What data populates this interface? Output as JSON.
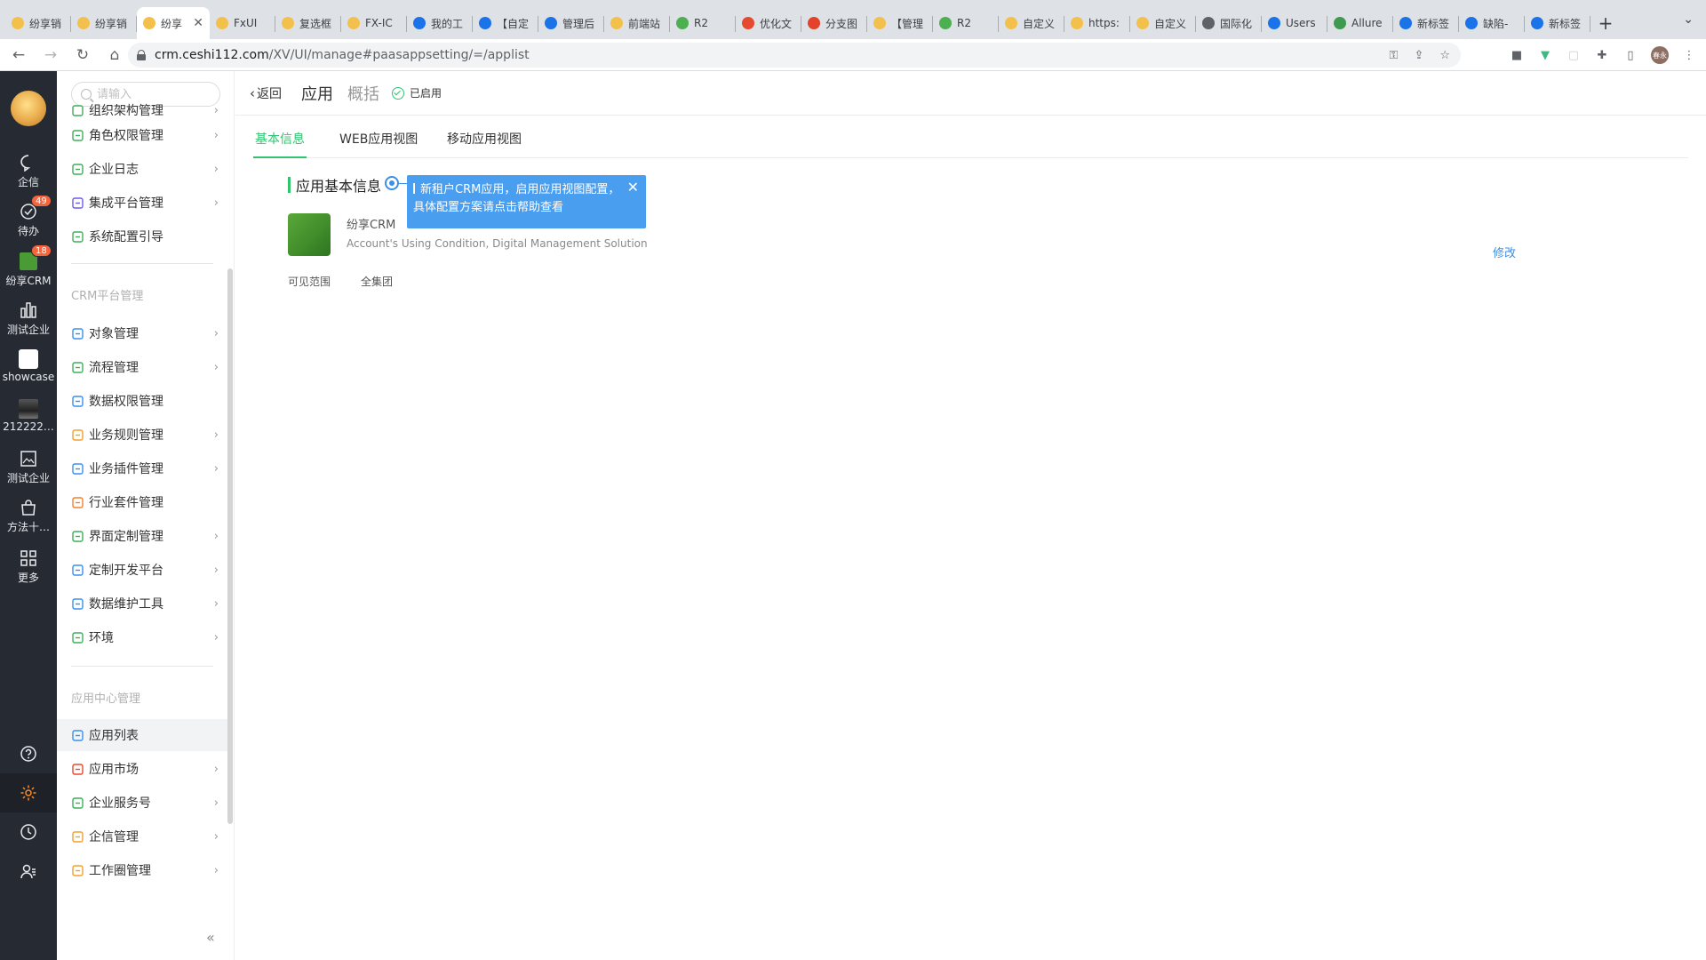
{
  "browser": {
    "tabs": [
      {
        "label": "纷享销",
        "favicon": "#f3c14b"
      },
      {
        "label": "纷享销",
        "favicon": "#f3c14b"
      },
      {
        "label": "纷享",
        "favicon": "#f3c14b",
        "active": true
      },
      {
        "label": "FxUI",
        "favicon": "#f3c14b"
      },
      {
        "label": "复选框",
        "favicon": "#f3c14b"
      },
      {
        "label": "FX-IC",
        "favicon": "#f3c14b"
      },
      {
        "label": "我的工",
        "favicon": "#1a73e8"
      },
      {
        "label": "【自定",
        "favicon": "#1a73e8"
      },
      {
        "label": "管理后",
        "favicon": "#1a73e8"
      },
      {
        "label": "前端站",
        "favicon": "#f3c14b"
      },
      {
        "label": "R2",
        "favicon": "#4caf50"
      },
      {
        "label": "优化文",
        "favicon": "#e5492f"
      },
      {
        "label": "分支图",
        "favicon": "#e24329"
      },
      {
        "label": "【管理",
        "favicon": "#f3c14b"
      },
      {
        "label": "R2",
        "favicon": "#4caf50"
      },
      {
        "label": "自定义",
        "favicon": "#f3c14b"
      },
      {
        "label": "https:",
        "favicon": "#f3c14b"
      },
      {
        "label": "自定义",
        "favicon": "#f3c14b"
      },
      {
        "label": "国际化",
        "favicon": "#5f6368"
      },
      {
        "label": "Users",
        "favicon": "#1a73e8"
      },
      {
        "label": "Allure",
        "favicon": "#3f9a4f"
      },
      {
        "label": "新标签",
        "favicon": "#1a73e8"
      },
      {
        "label": "缺陷-",
        "favicon": "#1a73e8"
      },
      {
        "label": "新标签",
        "favicon": "#1a73e8"
      }
    ],
    "tab_close": "✕",
    "new_tab": "+",
    "url_host": "crm.ceshi112.com",
    "url_path": "/XV/UI/manage#paasappsetting/=/applist",
    "profile_initials": "春永"
  },
  "rail": {
    "items": [
      {
        "label": "企信",
        "icon": "chat-bubble-icon"
      },
      {
        "label": "待办",
        "icon": "check-circle-icon",
        "badge": "49"
      },
      {
        "label": "纷享CRM",
        "icon": "crm-app-icon",
        "badge": "18"
      },
      {
        "label": "测试企业",
        "icon": "chart-bars-icon"
      },
      {
        "label": "showcase",
        "icon": "white-square-icon"
      },
      {
        "label": "212222…",
        "icon": "image-thumb-icon"
      },
      {
        "label": "测试企业",
        "icon": "broken-image-icon"
      },
      {
        "label": "方法十…",
        "icon": "shopping-bag-icon"
      },
      {
        "label": "更多",
        "icon": "grid-icon"
      }
    ],
    "bottom": [
      {
        "icon": "help-icon"
      },
      {
        "icon": "settings-icon",
        "active": true
      },
      {
        "icon": "clock-icon"
      },
      {
        "icon": "contacts-icon"
      }
    ]
  },
  "menu": {
    "search_placeholder": "请输入",
    "partial_item": "组织架构管理",
    "items_group1": [
      {
        "label": "角色权限管理",
        "arrow": true,
        "color": "#3fae5a"
      },
      {
        "label": "企业日志",
        "arrow": true,
        "color": "#3fae5a"
      },
      {
        "label": "集成平台管理",
        "arrow": true,
        "color": "#6c5ce7"
      },
      {
        "label": "系统配置引导",
        "arrow": false,
        "color": "#3fae5a"
      }
    ],
    "group2_title": "CRM平台管理",
    "items_group2": [
      {
        "label": "对象管理",
        "arrow": true,
        "color": "#3b8fe8"
      },
      {
        "label": "流程管理",
        "arrow": true,
        "color": "#3fae5a"
      },
      {
        "label": "数据权限管理",
        "arrow": false,
        "color": "#3b8fe8"
      },
      {
        "label": "业务规则管理",
        "arrow": true,
        "color": "#f0a030"
      },
      {
        "label": "业务插件管理",
        "arrow": true,
        "color": "#3b8fe8"
      },
      {
        "label": "行业套件管理",
        "arrow": false,
        "color": "#f08030"
      },
      {
        "label": "界面定制管理",
        "arrow": true,
        "color": "#3fae5a"
      },
      {
        "label": "定制开发平台",
        "arrow": true,
        "color": "#3b8fe8"
      },
      {
        "label": "数据维护工具",
        "arrow": true,
        "color": "#3b8fe8"
      },
      {
        "label": "环境",
        "arrow": true,
        "color": "#3fae5a"
      }
    ],
    "group3_title": "应用中心管理",
    "items_group3": [
      {
        "label": "应用列表",
        "arrow": false,
        "color": "#3b8fe8",
        "active": true
      },
      {
        "label": "应用市场",
        "arrow": true,
        "color": "#e5492f"
      },
      {
        "label": "企业服务号",
        "arrow": true,
        "color": "#3fae5a"
      },
      {
        "label": "企信管理",
        "arrow": true,
        "color": "#f0a030"
      },
      {
        "label": "工作圈管理",
        "arrow": true,
        "color": "#f0a030"
      }
    ],
    "collapse": "«"
  },
  "main": {
    "back": "返回",
    "tab_app": "应用",
    "tab_overview": "概括",
    "status": "已启用",
    "subtabs": [
      "基本信息",
      "WEB应用视图",
      "移动应用视图"
    ],
    "section_title": "应用基本信息",
    "guide_text": "新租户CRM应用，启用应用视图配置，具体配置方案请点击帮助查看",
    "guide_close": "✕",
    "app_name": "纷享CRM",
    "app_desc": "Account's Using Condition, Digital Management Solution",
    "edit": "修改",
    "scope_label": "可见范围",
    "scope_value": "全集团"
  },
  "colors": {
    "accent_green": "#30c46f",
    "link_blue": "#3b8fe8",
    "rail_bg": "#262b33",
    "badge": "#f5643c"
  }
}
